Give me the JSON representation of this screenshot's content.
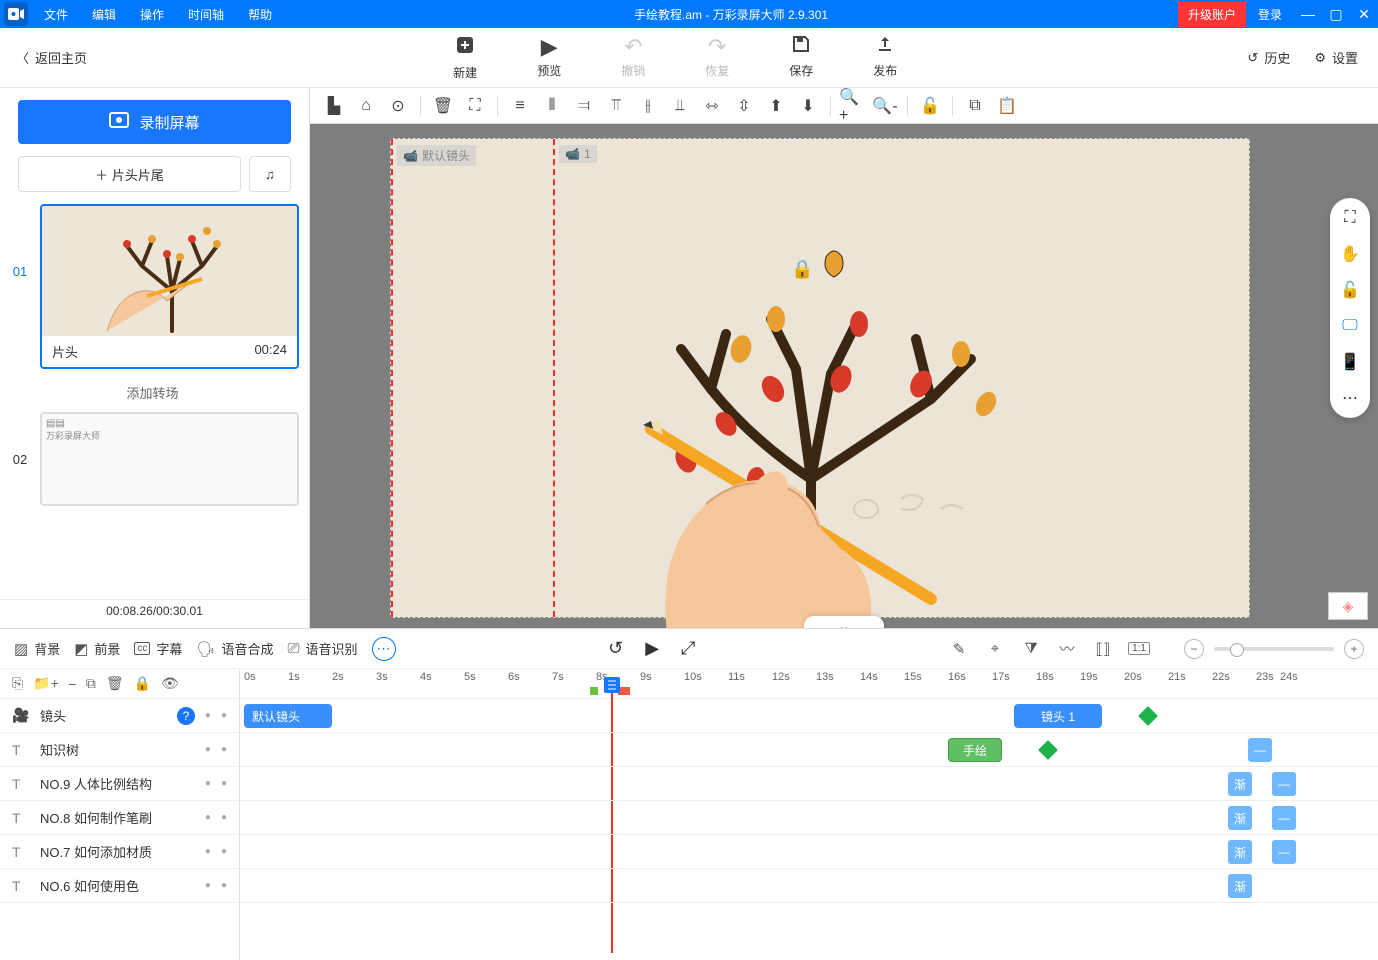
{
  "titlebar": {
    "menus": [
      "文件",
      "编辑",
      "操作",
      "时间轴",
      "帮助"
    ],
    "title": "手绘教程.am - 万彩录屏大师 2.9.301",
    "upgrade": "升级账户",
    "login": "登录"
  },
  "toolbar": {
    "back": "返回主页",
    "buttons": [
      {
        "label": "新建",
        "icon": "＋",
        "disabled": false
      },
      {
        "label": "预览",
        "icon": "▶",
        "disabled": false
      },
      {
        "label": "撤销",
        "icon": "↶",
        "disabled": true
      },
      {
        "label": "恢复",
        "icon": "↷",
        "disabled": true
      },
      {
        "label": "保存",
        "icon": "💾",
        "disabled": false
      },
      {
        "label": "发布",
        "icon": "⤴",
        "disabled": false
      }
    ],
    "history": "历史",
    "settings": "设置"
  },
  "left": {
    "record": "录制屏幕",
    "clip_btn": "片头片尾",
    "scenes": [
      {
        "num": "01",
        "name": "片头",
        "dur": "00:24",
        "active": true
      },
      {
        "num": "02",
        "name": "",
        "dur": "",
        "active": false
      }
    ],
    "add_transition": "添加转场",
    "time_status": "00:08.26/00:30.01"
  },
  "canvas": {
    "cam1": "默认镜头",
    "cam2": "1"
  },
  "timeline": {
    "tabs": [
      {
        "icon": "▨",
        "label": "背景"
      },
      {
        "icon": "◩",
        "label": "前景"
      },
      {
        "icon": "cc",
        "label": "字幕"
      },
      {
        "icon": "🗣",
        "label": "语音合成"
      },
      {
        "icon": "⎚",
        "label": "语音识别"
      }
    ],
    "ruler": [
      "0s",
      "1s",
      "2s",
      "3s",
      "4s",
      "5s",
      "6s",
      "7s",
      "8s",
      "9s",
      "10s",
      "11s",
      "12s",
      "13s",
      "14s",
      "15s",
      "16s",
      "17s",
      "18s",
      "19s",
      "20s",
      "21s",
      "22s",
      "23s",
      "24s"
    ],
    "tracks": [
      {
        "icon": "🎥",
        "name": "镜头",
        "help": true
      },
      {
        "icon": "T",
        "name": "知识树"
      },
      {
        "icon": "T",
        "name": "NO.9  人体比例结构"
      },
      {
        "icon": "T",
        "name": "NO.8  如何制作笔刷"
      },
      {
        "icon": "T",
        "name": "NO.7  如何添加材质"
      },
      {
        "icon": "T",
        "name": "NO.6  如何使用色"
      }
    ],
    "clips": {
      "default_cam": "默认镜头",
      "cam1": "镜头 1",
      "hand": "手绘",
      "fade": "渐",
      "dash": "—"
    }
  }
}
